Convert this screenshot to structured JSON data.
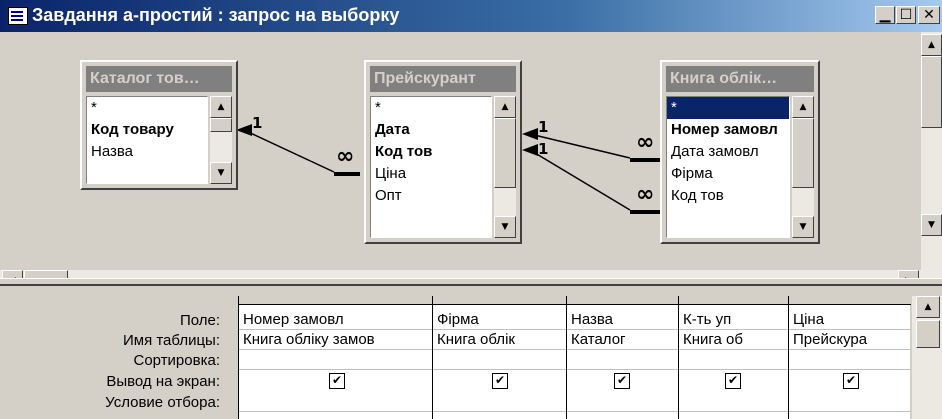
{
  "window": {
    "title": "Завдання а-простий : запрос на выборку",
    "buttons": {
      "minimize": "▁",
      "maximize": "☐",
      "close": "✕"
    }
  },
  "tables": [
    {
      "name": "Каталог тов…",
      "fields": [
        "*",
        "Код товару",
        "Назва"
      ]
    },
    {
      "name": "Прейскурант",
      "fields": [
        "*",
        "Дата",
        "Код тов",
        "Ціна",
        "Опт"
      ]
    },
    {
      "name": "Книга облік…",
      "fields": [
        "*",
        "Номер замовл",
        "Дата замовл",
        "Фірма",
        "Код тов"
      ]
    }
  ],
  "relations": {
    "one": "1",
    "many": "∞"
  },
  "grid": {
    "row_labels": [
      "Поле:",
      "Имя таблицы:",
      "Сортировка:",
      "Вывод на экран:",
      "Условие отбора:"
    ],
    "columns": [
      {
        "field": "Номер замовл",
        "table": "Книга обліку замов",
        "sort": "",
        "show": true
      },
      {
        "field": "Фірма",
        "table": "Книга облік",
        "sort": "",
        "show": true
      },
      {
        "field": "Назва",
        "table": "Каталог",
        "sort": "",
        "show": true
      },
      {
        "field": "К-ть уп",
        "table": "Книга об",
        "sort": "",
        "show": true
      },
      {
        "field": "Ціна",
        "table": "Прейскура",
        "sort": "",
        "show": true
      }
    ],
    "check_glyph": "✔"
  }
}
